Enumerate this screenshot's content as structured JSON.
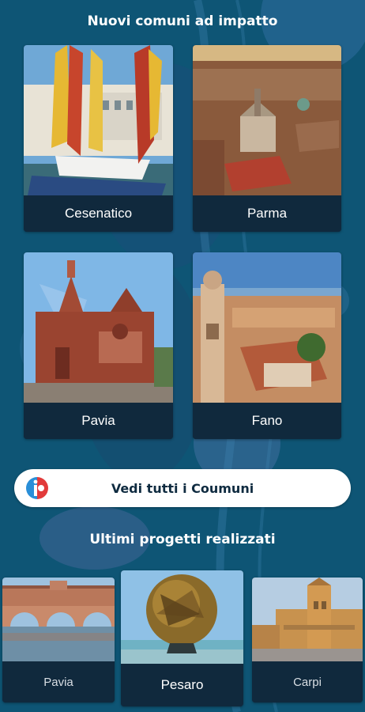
{
  "sections": {
    "new_municipalities_title": "Nuovi comuni ad impatto",
    "latest_projects_title": "Ultimi progetti realizzati"
  },
  "municipalities": [
    {
      "label": "Cesenatico"
    },
    {
      "label": "Parma"
    },
    {
      "label": "Pavia"
    },
    {
      "label": "Fano"
    }
  ],
  "see_all_button": {
    "label": "Vedi tutti i Coumuni"
  },
  "projects": [
    {
      "label": "Pavia"
    },
    {
      "label": "Pesaro"
    },
    {
      "label": "Carpi"
    }
  ],
  "colors": {
    "background": "#0d5170",
    "card_label_bg": "#10293d",
    "button_bg": "#ffffff",
    "logo_red": "#e23b3b",
    "logo_blue": "#2a8fd8"
  }
}
